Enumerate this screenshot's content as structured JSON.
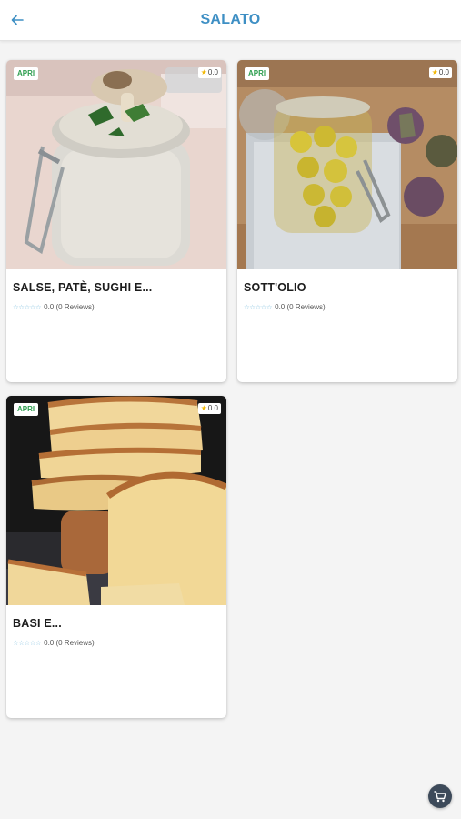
{
  "colors": {
    "accent": "#3e8fc4",
    "badge_text": "#2e9e4f",
    "star": "#f2b806",
    "star_empty": "#8fc7e2",
    "cart_bg": "#3d4a5a"
  },
  "header": {
    "title": "SALATO",
    "back_icon": "arrow-left-icon"
  },
  "cards": [
    {
      "name": "SALSE, PATÈ, SUGHI E...",
      "badge": "APRI",
      "rating_badge": "0.0",
      "rating_text": "0.0 (0 Reviews)",
      "stars": "☆☆☆☆☆",
      "image": "mushroom-sauce-jar"
    },
    {
      "name": "SOTT'OLIO",
      "badge": "APRI",
      "rating_badge": "0.0",
      "rating_text": "0.0 (0 Reviews)",
      "stars": "☆☆☆☆☆",
      "image": "artichokes-in-oil-jar"
    },
    {
      "name": "BASI E...",
      "badge": "APRI",
      "rating_badge": "0.0",
      "rating_text": "0.0 (0 Reviews)",
      "stars": "☆☆☆☆☆",
      "image": "sliced-bread"
    }
  ],
  "fab": {
    "icon": "shopping-cart-icon"
  }
}
